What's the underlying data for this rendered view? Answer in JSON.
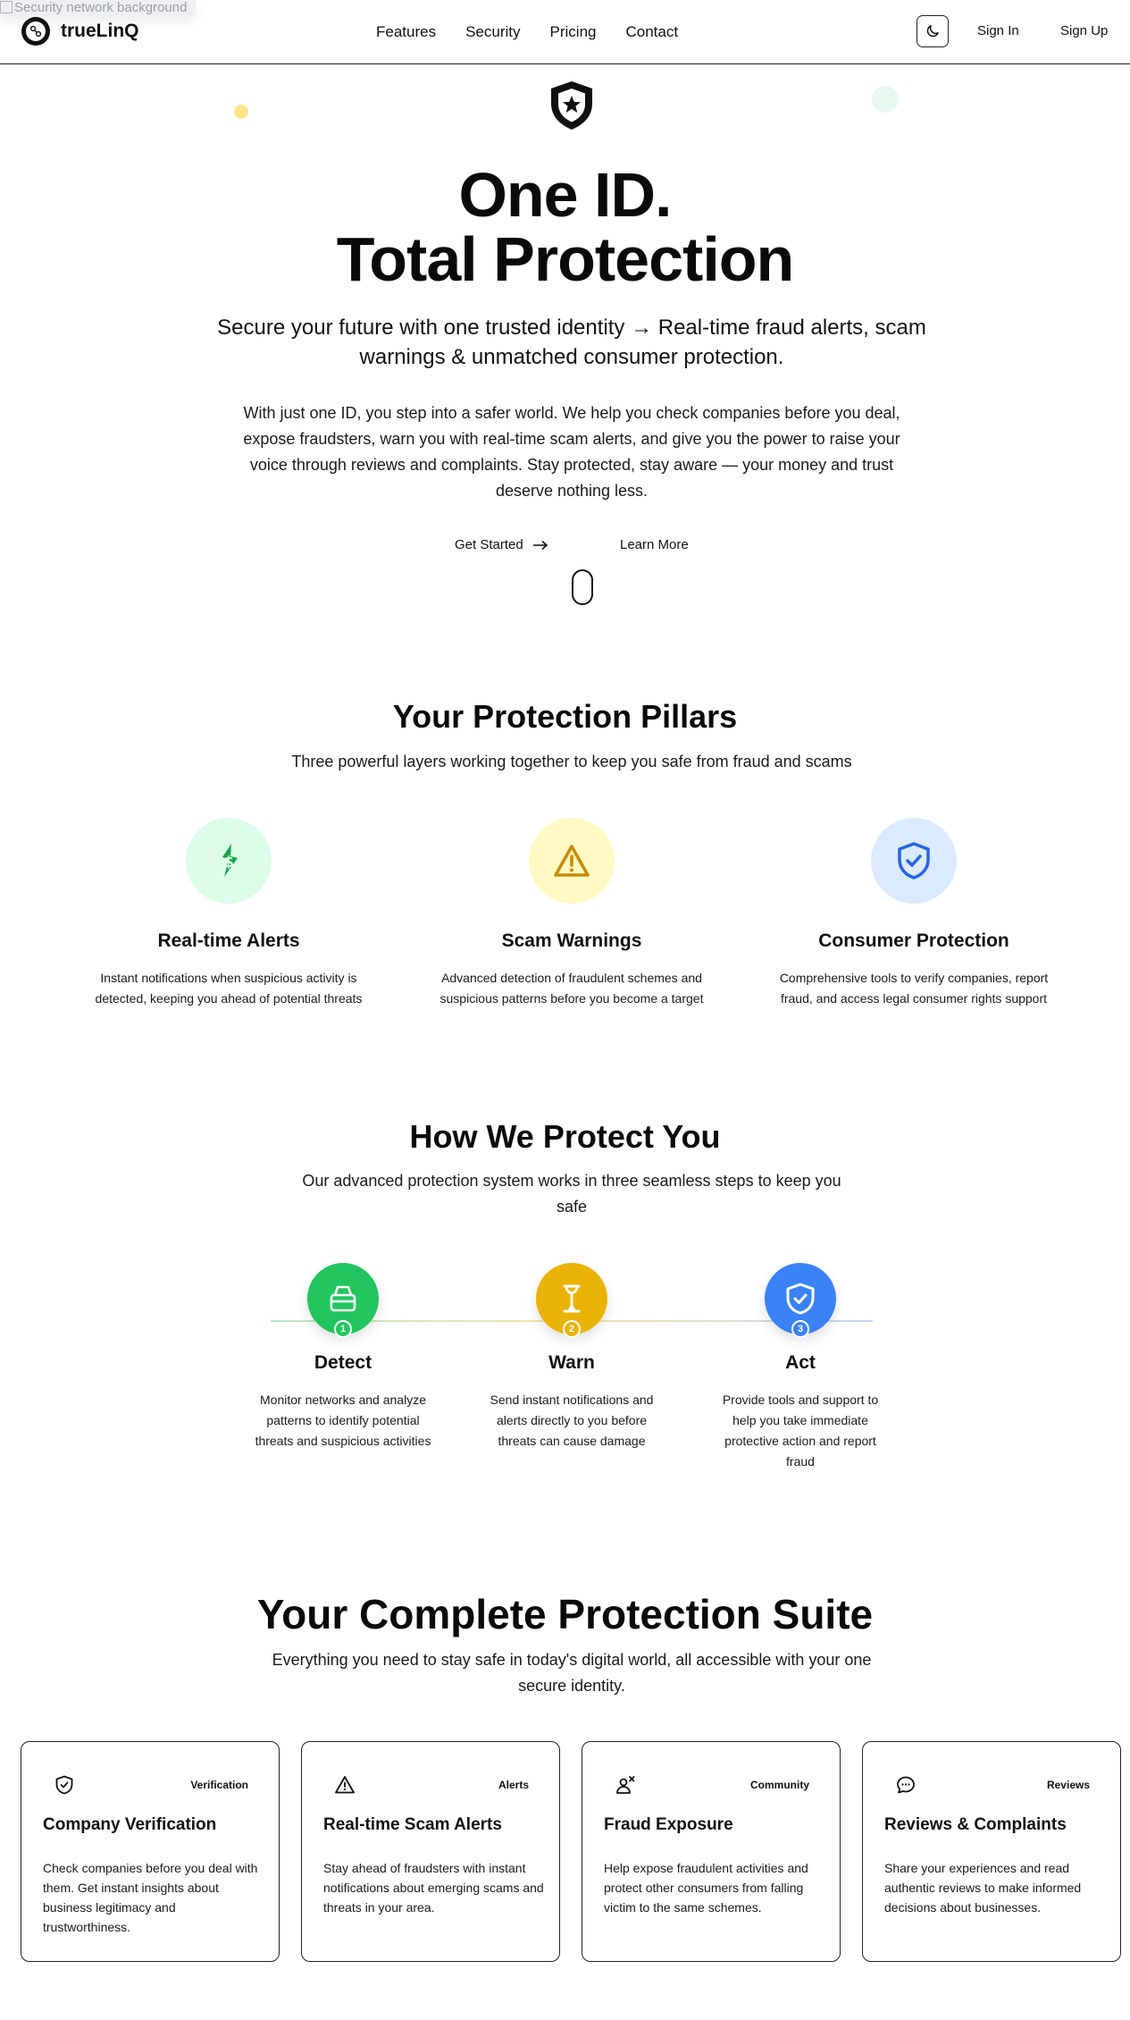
{
  "broken_image": {
    "alt": "Security network background"
  },
  "nav": {
    "brand": "trueLinQ",
    "links": [
      "Features",
      "Security",
      "Pricing",
      "Contact"
    ],
    "sign_in": "Sign In",
    "sign_up": "Sign Up",
    "theme_icon": "moon-icon"
  },
  "hero": {
    "title_line1": "One ID.",
    "title_line2": "Total Protection",
    "subtitle": "Secure your future with one trusted identity → Real-time fraud alerts, scam warnings & unmatched consumer protection.",
    "body": "With just one ID, you step into a safer world. We help you check companies before you deal, expose fraudsters, warn you with real-time scam alerts, and give you the power to raise your voice through reviews and complaints. Stay protected, stay aware — your money and trust deserve nothing less.",
    "cta_primary": "Get Started",
    "cta_secondary": "Learn More"
  },
  "pillars": {
    "title": "Your Protection Pillars",
    "subtitle": "Three powerful layers working together to keep you safe from fraud and scams",
    "items": [
      {
        "title": "Real-time Alerts",
        "desc": "Instant notifications when suspicious activity is detected, keeping you ahead of potential threats",
        "icon": "dollar-alert-icon",
        "color": "#16a34a",
        "bg": "#dcfce7"
      },
      {
        "title": "Scam Warnings",
        "desc": "Advanced detection of fraudulent schemes and suspicious patterns before you become a target",
        "icon": "warning-triangle-icon",
        "color": "#ca8a04",
        "bg": "#fef9c3"
      },
      {
        "title": "Consumer Protection",
        "desc": "Comprehensive tools to verify companies, report fraud, and access legal consumer rights support",
        "icon": "shield-check-icon",
        "color": "#2563eb",
        "bg": "#dbeafe"
      }
    ]
  },
  "steps": {
    "title": "How We Protect You",
    "subtitle": "Our advanced protection system works in three seamless steps to keep you safe",
    "items": [
      {
        "num": "1",
        "title": "Detect",
        "desc": "Monitor networks and analyze patterns to identify potential threats and suspicious activities",
        "icon": "inbox-stack-icon",
        "color": "#22c55e"
      },
      {
        "num": "2",
        "title": "Warn",
        "desc": "Send instant notifications and alerts directly to you before threats can cause damage",
        "icon": "hourglass-icon",
        "color": "#eab308"
      },
      {
        "num": "3",
        "title": "Act",
        "desc": "Provide tools and support to help you take immediate protective action and report fraud",
        "icon": "shield-check-icon",
        "color": "#3b82f6"
      }
    ]
  },
  "suite": {
    "title": "Your Complete Protection Suite",
    "subtitle": "Everything you need to stay safe in today's digital world, all accessible with your one secure identity.",
    "cards": [
      {
        "tag": "Verification",
        "title": "Company Verification",
        "desc": "Check companies before you deal with them. Get instant insights about business legitimacy and trustworthiness.",
        "icon": "shield-check-icon"
      },
      {
        "tag": "Alerts",
        "title": "Real-time Scam Alerts",
        "desc": "Stay ahead of fraudsters with instant notifications about emerging scams and threats in your area.",
        "icon": "warning-triangle-icon"
      },
      {
        "tag": "Community",
        "title": "Fraud Exposure",
        "desc": "Help expose fraudulent activities and protect other consumers from falling victim to the same schemes.",
        "icon": "user-x-icon"
      },
      {
        "tag": "Reviews",
        "title": "Reviews & Complaints",
        "desc": "Share your experiences and read authentic reviews to make informed decisions about businesses.",
        "icon": "chat-bubble-icon"
      }
    ]
  }
}
